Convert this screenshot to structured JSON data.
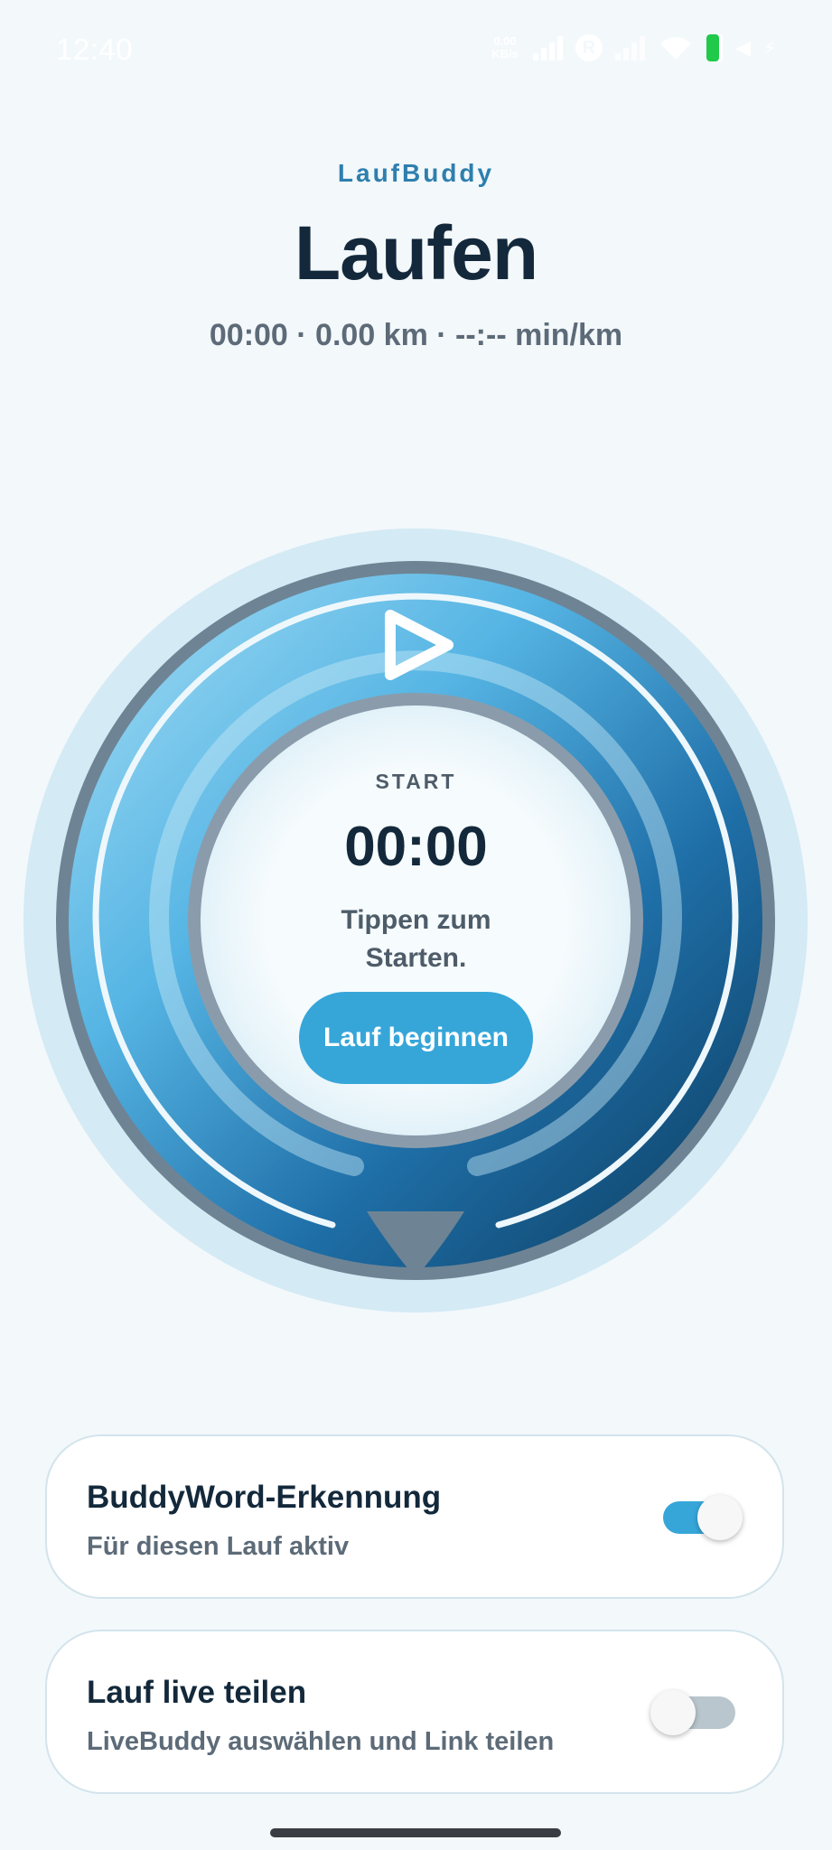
{
  "status_bar": {
    "time": "12:40",
    "net_speed": "0.00 KB/s",
    "icons": [
      "signal-icon",
      "r-circle-icon",
      "signal-dim-icon",
      "wifi-icon",
      "battery-icon",
      "mute-icon",
      "charging-icon"
    ],
    "battery_color": "#21c94a"
  },
  "header": {
    "brand": "LaufBuddy",
    "title": "Laufen",
    "stats": "00:00 · 0.00 km · --:-- min/km"
  },
  "dial": {
    "icon": "play-icon",
    "label": "START",
    "timer": "00:00",
    "hint": "Tippen zum Starten.",
    "button_label": "Lauf beginnen",
    "colors": {
      "light": "#8fd3f0",
      "mid": "#2d8cc8",
      "dark": "#0d3f62",
      "button": "#36a6d9"
    }
  },
  "cards": [
    {
      "title": "BuddyWord-Erkennung",
      "subtitle": "Für diesen Lauf aktiv",
      "toggle_on": true
    },
    {
      "title": "Lauf live teilen",
      "subtitle": "LiveBuddy auswählen und Link teilen",
      "toggle_on": false
    }
  ]
}
